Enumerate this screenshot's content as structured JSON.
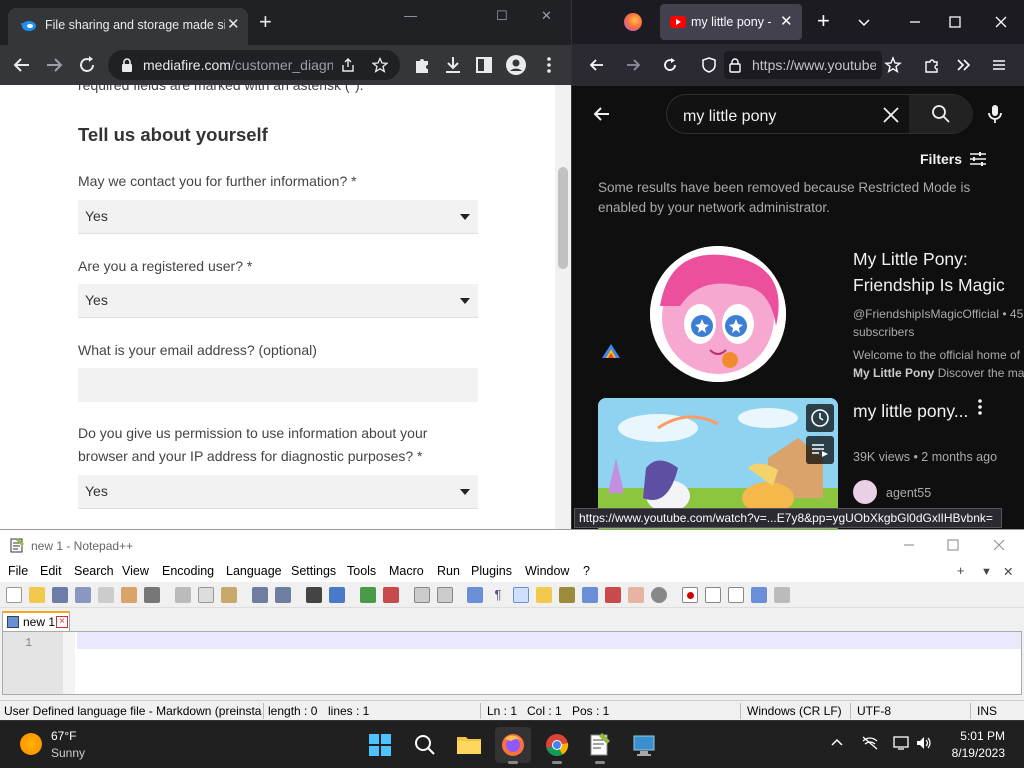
{
  "chrome": {
    "tab_title": "File sharing and storage made simple",
    "close": "✕",
    "new_tab": "+",
    "min": "—",
    "max": "☐",
    "win_close": "✕",
    "url_domain": "mediafire.com",
    "url_path": "/customer_diagnostics",
    "form": {
      "required_note": "required fields are marked with an asterisk (*).",
      "heading": "Tell us about yourself",
      "q1": "May we contact you for further information? *",
      "q1_value": "Yes",
      "q2": "Are you a registered user? *",
      "q2_value": "Yes",
      "q3": "What is your email address? (optional)",
      "q3_value": "",
      "q4": "Do you give us permission to use information about your browser and your IP address for diagnostic purposes? *",
      "q4_value": "Yes"
    }
  },
  "firefox": {
    "tab_title": "my little pony - YouTube",
    "close": "✕",
    "new_tab": "+",
    "url": "https://www.youtube.com/results?search_query=my+little+pony",
    "search_query": "my little pony",
    "filters_label": "Filters",
    "restricted_notice": "Some results have been removed because Restricted Mode is enabled by your network administrator.",
    "channel": {
      "name": "My Little Pony: Friendship Is Magic",
      "handle": "@FriendshipIsMagicOfficial",
      "subs_prefix": "• 45",
      "subs": "subscribers",
      "desc_prefix": "Welcome to the official home of",
      "desc_bold": "My Little Pony",
      "desc_rest": "Discover the magic"
    },
    "video": {
      "title": "my little pony...",
      "meta": "39K views • 2 months ago",
      "channel": "agent55"
    },
    "status_url": "https://www.youtube.com/watch?v=...E7y8&pp=ygUObXkgbGl0dGxlIHBvbnk="
  },
  "notepad": {
    "title": "new 1 - Notepad++",
    "menus": [
      "File",
      "Edit",
      "Search",
      "View",
      "Encoding",
      "Language",
      "Settings",
      "Tools",
      "Macro",
      "Run",
      "Plugins",
      "Window",
      "?"
    ],
    "tab_label": "new 1",
    "line_number": "1",
    "status": {
      "lang": "User Defined language file - Markdown (preinstalled)",
      "length": "length : 0",
      "lines": "lines : 1",
      "ln": "Ln : 1",
      "col": "Col : 1",
      "pos": "Pos : 1",
      "eol": "Windows (CR LF)",
      "enc": "UTF-8",
      "mode": "INS"
    },
    "plus": "+",
    "dropdown": "▼",
    "close": "✕"
  },
  "taskbar": {
    "temp": "67°F",
    "condition": "Sunny",
    "time": "5:01 PM",
    "date": "8/19/2023"
  }
}
